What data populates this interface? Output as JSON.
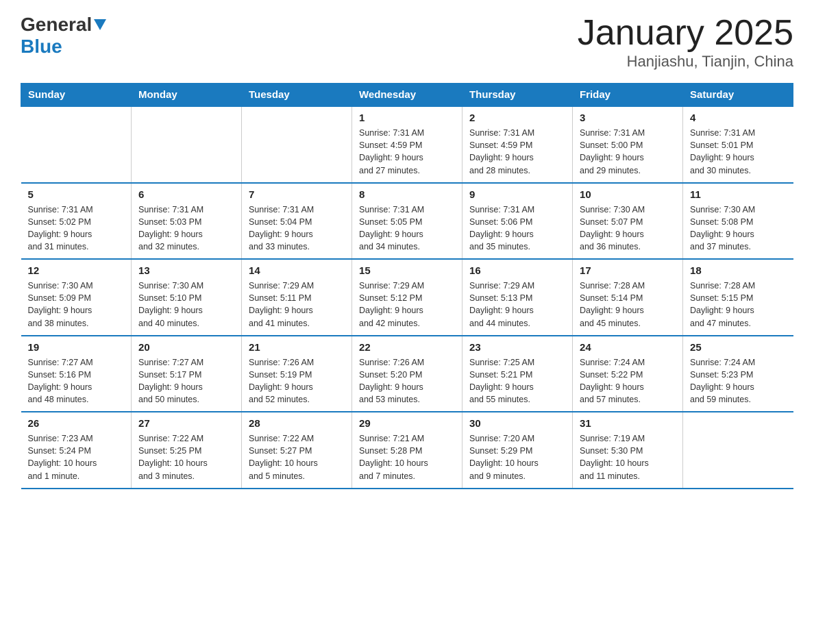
{
  "header": {
    "logo_general": "General",
    "logo_blue": "Blue",
    "title": "January 2025",
    "subtitle": "Hanjiashu, Tianjin, China"
  },
  "days_of_week": [
    "Sunday",
    "Monday",
    "Tuesday",
    "Wednesday",
    "Thursday",
    "Friday",
    "Saturday"
  ],
  "weeks": [
    [
      {
        "day": "",
        "info": ""
      },
      {
        "day": "",
        "info": ""
      },
      {
        "day": "",
        "info": ""
      },
      {
        "day": "1",
        "info": "Sunrise: 7:31 AM\nSunset: 4:59 PM\nDaylight: 9 hours\nand 27 minutes."
      },
      {
        "day": "2",
        "info": "Sunrise: 7:31 AM\nSunset: 4:59 PM\nDaylight: 9 hours\nand 28 minutes."
      },
      {
        "day": "3",
        "info": "Sunrise: 7:31 AM\nSunset: 5:00 PM\nDaylight: 9 hours\nand 29 minutes."
      },
      {
        "day": "4",
        "info": "Sunrise: 7:31 AM\nSunset: 5:01 PM\nDaylight: 9 hours\nand 30 minutes."
      }
    ],
    [
      {
        "day": "5",
        "info": "Sunrise: 7:31 AM\nSunset: 5:02 PM\nDaylight: 9 hours\nand 31 minutes."
      },
      {
        "day": "6",
        "info": "Sunrise: 7:31 AM\nSunset: 5:03 PM\nDaylight: 9 hours\nand 32 minutes."
      },
      {
        "day": "7",
        "info": "Sunrise: 7:31 AM\nSunset: 5:04 PM\nDaylight: 9 hours\nand 33 minutes."
      },
      {
        "day": "8",
        "info": "Sunrise: 7:31 AM\nSunset: 5:05 PM\nDaylight: 9 hours\nand 34 minutes."
      },
      {
        "day": "9",
        "info": "Sunrise: 7:31 AM\nSunset: 5:06 PM\nDaylight: 9 hours\nand 35 minutes."
      },
      {
        "day": "10",
        "info": "Sunrise: 7:30 AM\nSunset: 5:07 PM\nDaylight: 9 hours\nand 36 minutes."
      },
      {
        "day": "11",
        "info": "Sunrise: 7:30 AM\nSunset: 5:08 PM\nDaylight: 9 hours\nand 37 minutes."
      }
    ],
    [
      {
        "day": "12",
        "info": "Sunrise: 7:30 AM\nSunset: 5:09 PM\nDaylight: 9 hours\nand 38 minutes."
      },
      {
        "day": "13",
        "info": "Sunrise: 7:30 AM\nSunset: 5:10 PM\nDaylight: 9 hours\nand 40 minutes."
      },
      {
        "day": "14",
        "info": "Sunrise: 7:29 AM\nSunset: 5:11 PM\nDaylight: 9 hours\nand 41 minutes."
      },
      {
        "day": "15",
        "info": "Sunrise: 7:29 AM\nSunset: 5:12 PM\nDaylight: 9 hours\nand 42 minutes."
      },
      {
        "day": "16",
        "info": "Sunrise: 7:29 AM\nSunset: 5:13 PM\nDaylight: 9 hours\nand 44 minutes."
      },
      {
        "day": "17",
        "info": "Sunrise: 7:28 AM\nSunset: 5:14 PM\nDaylight: 9 hours\nand 45 minutes."
      },
      {
        "day": "18",
        "info": "Sunrise: 7:28 AM\nSunset: 5:15 PM\nDaylight: 9 hours\nand 47 minutes."
      }
    ],
    [
      {
        "day": "19",
        "info": "Sunrise: 7:27 AM\nSunset: 5:16 PM\nDaylight: 9 hours\nand 48 minutes."
      },
      {
        "day": "20",
        "info": "Sunrise: 7:27 AM\nSunset: 5:17 PM\nDaylight: 9 hours\nand 50 minutes."
      },
      {
        "day": "21",
        "info": "Sunrise: 7:26 AM\nSunset: 5:19 PM\nDaylight: 9 hours\nand 52 minutes."
      },
      {
        "day": "22",
        "info": "Sunrise: 7:26 AM\nSunset: 5:20 PM\nDaylight: 9 hours\nand 53 minutes."
      },
      {
        "day": "23",
        "info": "Sunrise: 7:25 AM\nSunset: 5:21 PM\nDaylight: 9 hours\nand 55 minutes."
      },
      {
        "day": "24",
        "info": "Sunrise: 7:24 AM\nSunset: 5:22 PM\nDaylight: 9 hours\nand 57 minutes."
      },
      {
        "day": "25",
        "info": "Sunrise: 7:24 AM\nSunset: 5:23 PM\nDaylight: 9 hours\nand 59 minutes."
      }
    ],
    [
      {
        "day": "26",
        "info": "Sunrise: 7:23 AM\nSunset: 5:24 PM\nDaylight: 10 hours\nand 1 minute."
      },
      {
        "day": "27",
        "info": "Sunrise: 7:22 AM\nSunset: 5:25 PM\nDaylight: 10 hours\nand 3 minutes."
      },
      {
        "day": "28",
        "info": "Sunrise: 7:22 AM\nSunset: 5:27 PM\nDaylight: 10 hours\nand 5 minutes."
      },
      {
        "day": "29",
        "info": "Sunrise: 7:21 AM\nSunset: 5:28 PM\nDaylight: 10 hours\nand 7 minutes."
      },
      {
        "day": "30",
        "info": "Sunrise: 7:20 AM\nSunset: 5:29 PM\nDaylight: 10 hours\nand 9 minutes."
      },
      {
        "day": "31",
        "info": "Sunrise: 7:19 AM\nSunset: 5:30 PM\nDaylight: 10 hours\nand 11 minutes."
      },
      {
        "day": "",
        "info": ""
      }
    ]
  ]
}
